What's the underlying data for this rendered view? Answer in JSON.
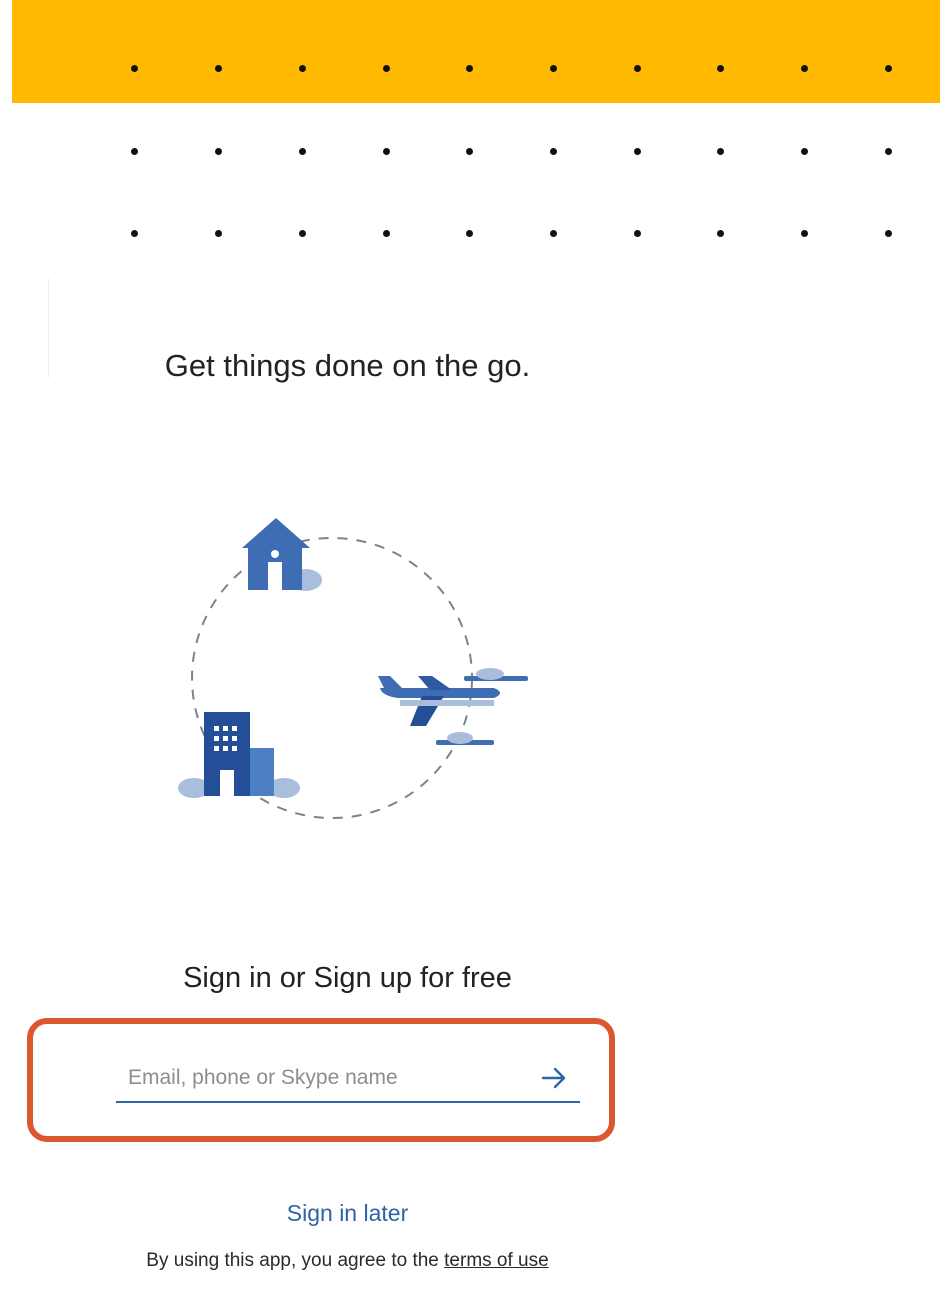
{
  "header": {
    "banner_color": "#ffb900"
  },
  "tagline": "Get things done on the go.",
  "illustration": {
    "icons": [
      "home-icon",
      "office-building-icon",
      "airplane-icon",
      "cloud-icon"
    ]
  },
  "signin": {
    "title": "Sign in or Sign up for free",
    "input_placeholder": "Email, phone or Skype name",
    "input_value": "",
    "submit_icon": "arrow-right-icon",
    "highlight_color": "#d9582e"
  },
  "footer": {
    "sign_in_later": "Sign in later",
    "agree_text": "By using this app, you agree to the ",
    "terms_link": "terms of use"
  },
  "colors": {
    "accent_blue": "#2d64a8",
    "banner_yellow": "#ffb900"
  }
}
